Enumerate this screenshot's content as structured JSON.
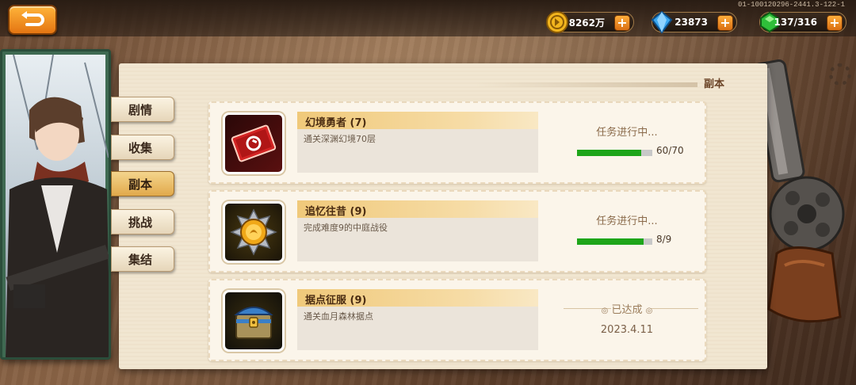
{
  "header": {
    "back_button_label": "",
    "version": "01-100120296-2441.3-122-1"
  },
  "resources": [
    {
      "icon": "gold-coin-icon",
      "value": "8262万"
    },
    {
      "icon": "blue-diamond-icon",
      "value": "23873"
    },
    {
      "icon": "green-gem-icon",
      "value": "137/316"
    }
  ],
  "panel_title": "副本",
  "tabs": [
    {
      "label": "剧情",
      "active": false
    },
    {
      "label": "收集",
      "active": false
    },
    {
      "label": "副本",
      "active": true
    },
    {
      "label": "挑战",
      "active": false
    },
    {
      "label": "集结",
      "active": false
    }
  ],
  "quests": [
    {
      "icon": "red-ticket-icon",
      "title": "幻境勇者 (7)",
      "description": "通关深渊幻境70层",
      "status": "任务进行中...",
      "progress_text": "60/70",
      "progress": 0.857
    },
    {
      "icon": "gold-medal-icon",
      "title": "追忆往昔 (9)",
      "description": "完成难度9的中庭战役",
      "status": "任务进行中...",
      "progress_text": "8/9",
      "progress": 0.889
    },
    {
      "icon": "treasure-chest-icon",
      "title": "据点征服 (9)",
      "description": "通关血月森林据点",
      "status": "已达成",
      "date": "2023.4.11"
    }
  ],
  "colors": {
    "accent": "#f0c97a",
    "progress_fill": "#1ea51a",
    "button_orange": "#e47512"
  }
}
